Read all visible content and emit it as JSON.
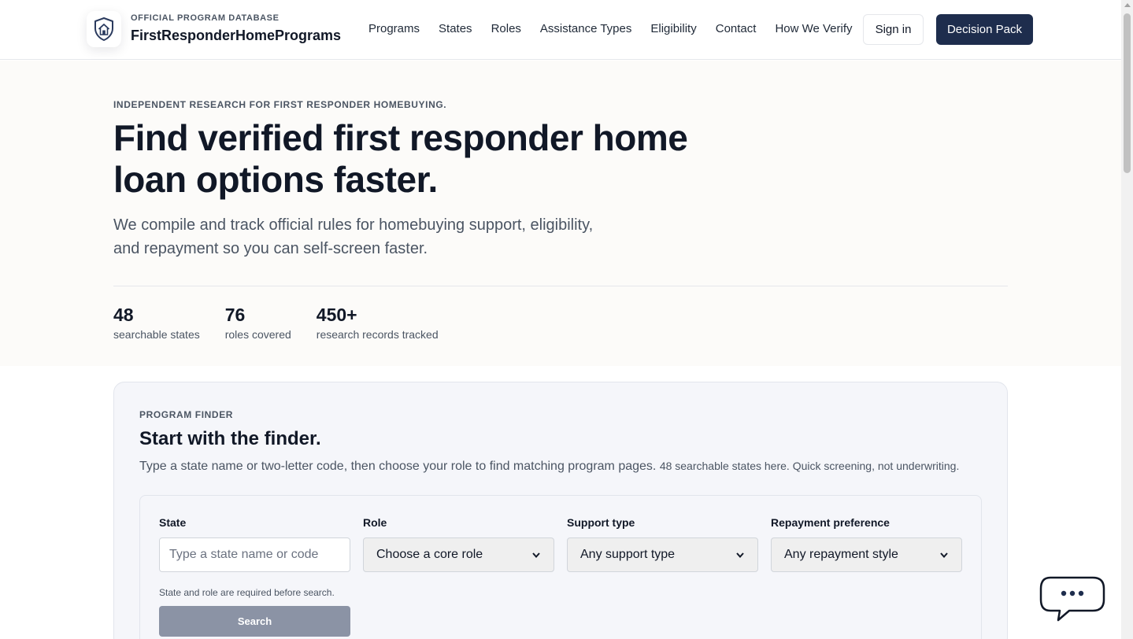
{
  "header": {
    "eyebrow": "OFFICIAL PROGRAM DATABASE",
    "brand": "FirstResponderHomePrograms",
    "logo_icon": "shield-house-icon",
    "nav": [
      {
        "label": "Programs"
      },
      {
        "label": "States"
      },
      {
        "label": "Roles"
      },
      {
        "label": "Assistance Types"
      },
      {
        "label": "Eligibility"
      },
      {
        "label": "Contact"
      },
      {
        "label": "How We Verify"
      }
    ],
    "signin_label": "Sign in",
    "cta_label": "Decision Pack"
  },
  "hero": {
    "eyebrow": "INDEPENDENT RESEARCH FOR FIRST RESPONDER HOMEBUYING.",
    "title": "Find verified first responder home loan options faster.",
    "subtitle": "We compile and track official rules for homebuying support, eligibility, and repayment so you can self-screen faster.",
    "stats": [
      {
        "value": "48",
        "label": "searchable states"
      },
      {
        "value": "76",
        "label": "roles covered"
      },
      {
        "value": "450+",
        "label": "research records tracked"
      }
    ]
  },
  "finder": {
    "eyebrow": "PROGRAM FINDER",
    "title": "Start with the finder.",
    "description": "Type a state name or two-letter code, then choose your role to find matching program pages.",
    "description_note": "48 searchable states here. Quick screening, not underwriting.",
    "fields": {
      "state": {
        "label": "State",
        "placeholder": "Type a state name or code",
        "value": ""
      },
      "role": {
        "label": "Role",
        "selected": "Choose a core role"
      },
      "support": {
        "label": "Support type",
        "selected": "Any support type"
      },
      "repayment": {
        "label": "Repayment preference",
        "selected": "Any repayment style"
      }
    },
    "hint": "State and role are required before search.",
    "search_label": "Search"
  },
  "chat": {
    "icon": "chat-bubble-icon"
  },
  "colors": {
    "brand_navy": "#1e2d4d",
    "hero_bg": "#fcfbf9",
    "card_bg": "#f5f6fa",
    "search_disabled": "#8b93a5"
  }
}
